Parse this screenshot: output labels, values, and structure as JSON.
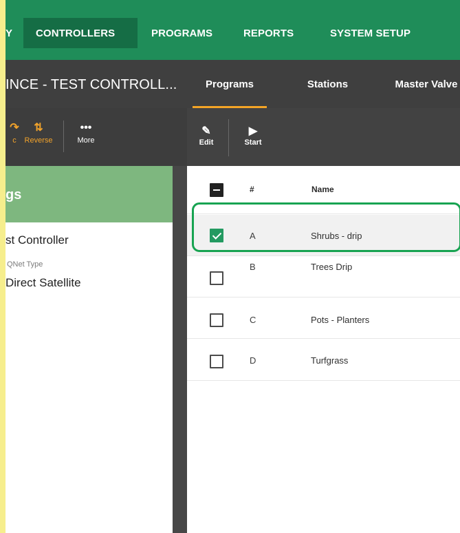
{
  "top_nav": {
    "items": [
      {
        "label": "Y"
      },
      {
        "label": "CONTROLLERS"
      },
      {
        "label": "PROGRAMS"
      },
      {
        "label": "REPORTS"
      },
      {
        "label": "SYSTEM SETUP"
      }
    ]
  },
  "sub_header": {
    "controller_title": "INCE - TEST CONTROLL...",
    "tabs": [
      {
        "label": "Programs"
      },
      {
        "label": "Stations"
      },
      {
        "label": "Master Valve"
      }
    ]
  },
  "left_toolbar": {
    "items": [
      {
        "label": "c",
        "icon": "arrow-icon"
      },
      {
        "label": "Reverse",
        "icon": "reverse-icon"
      },
      {
        "label": "More",
        "icon": "more-icon"
      }
    ]
  },
  "right_toolbar": {
    "items": [
      {
        "label": "Edit",
        "icon": "pencil-icon"
      },
      {
        "label": "Start",
        "icon": "play-icon"
      }
    ]
  },
  "settings_panel": {
    "title": "gs",
    "controller_name": "st Controller",
    "field_label": "QNet Type",
    "field_value": "Direct Satellite"
  },
  "programs_table": {
    "headers": {
      "number": "#",
      "name": "Name"
    },
    "rows": [
      {
        "number": "A",
        "name": "Shrubs - drip",
        "selected": true
      },
      {
        "number": "B",
        "name": "Trees Drip",
        "selected": false
      },
      {
        "number": "C",
        "name": "Pots - Planters",
        "selected": false
      },
      {
        "number": "D",
        "name": "Turfgrass",
        "selected": false
      }
    ]
  },
  "colors": {
    "top_nav": "#1f8d59",
    "active_nav": "#156d45",
    "accent_orange": "#f2a32b",
    "settings_green": "#7eb77f",
    "selection_green": "#17a351",
    "rail_yellow": "#f6ee8d"
  }
}
